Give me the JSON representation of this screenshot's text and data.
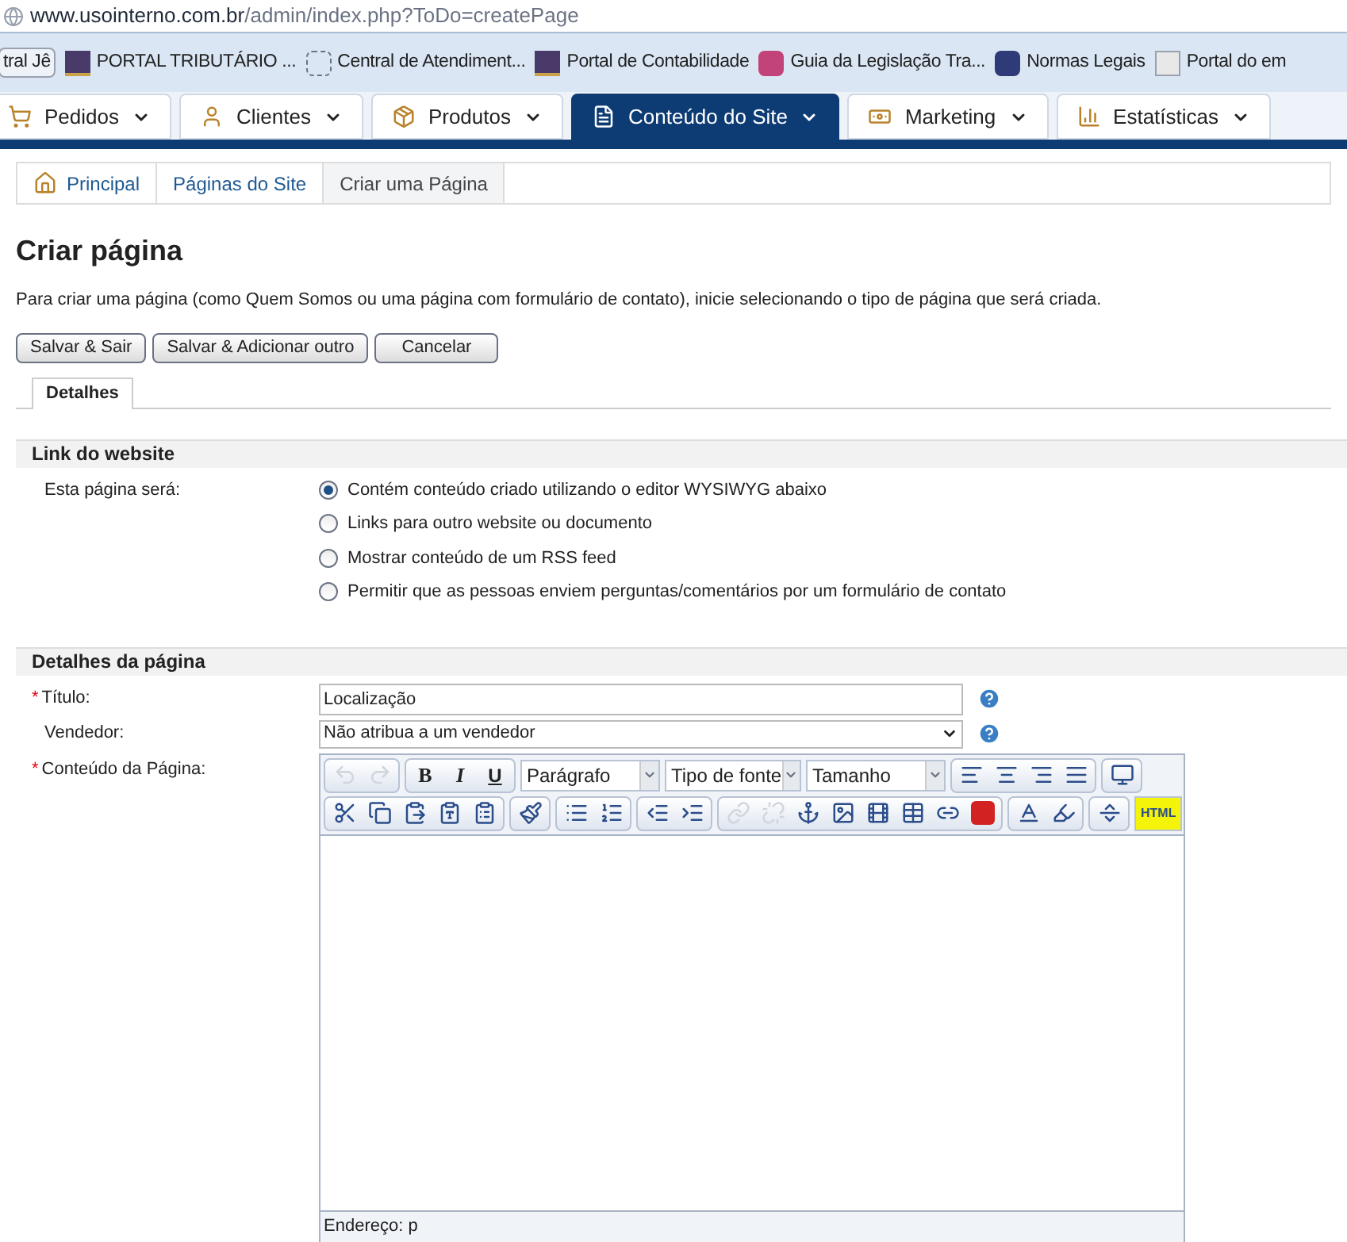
{
  "browser": {
    "url_host": "www.usointerno.com.br",
    "url_path": "/admin/index.php?ToDo=createPage",
    "bookmarks": [
      {
        "label": "tral Jê",
        "kind": "plain"
      },
      {
        "label": "PORTAL TRIBUTÁRIO ...",
        "kind": "portal"
      },
      {
        "label": "Central de Atendiment...",
        "kind": "dashed"
      },
      {
        "label": "Portal de Contabilidade",
        "kind": "portal"
      },
      {
        "label": "Guia da Legislação Tra...",
        "kind": "gt"
      },
      {
        "label": "Normas Legais",
        "kind": "nl"
      },
      {
        "label": "Portal do em",
        "kind": "e"
      }
    ]
  },
  "nav_tabs": [
    {
      "label": "Pedidos",
      "selected": false
    },
    {
      "label": "Clientes",
      "selected": false
    },
    {
      "label": "Produtos",
      "selected": false
    },
    {
      "label": "Conteúdo do Site",
      "selected": true
    },
    {
      "label": "Marketing",
      "selected": false
    },
    {
      "label": "Estatísticas",
      "selected": false
    }
  ],
  "breadcrumb": [
    {
      "label": "Principal",
      "current": false
    },
    {
      "label": "Páginas do Site",
      "current": false
    },
    {
      "label": "Criar uma Página",
      "current": true
    }
  ],
  "page_title": "Criar página",
  "description": "Para criar uma página (como Quem Somos ou uma página com formulário de contato), inicie selecionando o tipo de página que será criada.",
  "actions": [
    "Salvar & Sair",
    "Salvar & Adicionar outro",
    "Cancelar"
  ],
  "form_tabs": [
    {
      "label": "Detalhes",
      "selected": true
    }
  ],
  "link_section": {
    "title": "Link do website",
    "label": "Esta página será:",
    "options": [
      {
        "label": "Contém conteúdo criado utilizando o editor WYSIWYG abaixo",
        "selected": true
      },
      {
        "label": "Links para outro website ou documento",
        "selected": false
      },
      {
        "label": "Mostrar conteúdo de um RSS feed",
        "selected": false
      },
      {
        "label": "Permitir que as pessoas enviem perguntas/comentários por um formulário de contato",
        "selected": false
      }
    ]
  },
  "details_section": {
    "title": "Detalhes da página",
    "required_mark": "*",
    "title_field": {
      "label": "Título:",
      "required": true,
      "value": "Localização"
    },
    "vendor_field": {
      "label": "Vendedor:",
      "required": false,
      "value": "Não atribua a um vendedor"
    },
    "content_field": {
      "label": "Conteúdo da Página:",
      "required": true
    }
  },
  "editor": {
    "undo": {
      "disabled": true
    },
    "redo": {
      "disabled": true
    },
    "bold": "B",
    "italic": "I",
    "underline": "U",
    "dropdowns": [
      {
        "value": "Parágrafo"
      },
      {
        "value": "Tipo de fonte"
      },
      {
        "value": "Tamanho"
      }
    ],
    "link": {
      "disabled": true
    },
    "unlink": {
      "disabled": true
    },
    "html": {
      "label": "HTML",
      "highlighted": true
    },
    "status": "Endereço: p"
  }
}
